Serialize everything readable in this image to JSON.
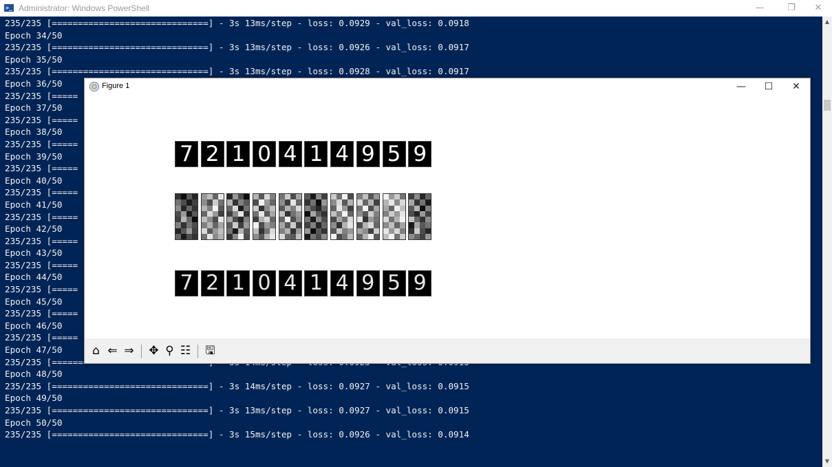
{
  "powershell": {
    "title": "Administrator: Windows PowerShell",
    "minimize": "—",
    "maximize": "❐",
    "close": "✕",
    "icon": "powershell-icon"
  },
  "console_lines": [
    "235/235 [==============================] - 3s 13ms/step - loss: 0.0929 - val_loss: 0.0918",
    "Epoch 34/50",
    "235/235 [==============================] - 3s 13ms/step - loss: 0.0926 - val_loss: 0.0917",
    "Epoch 35/50",
    "235/235 [==============================] - 3s 13ms/step - loss: 0.0928 - val_loss: 0.0917",
    "Epoch 36/50",
    "235/235 [=====",
    "Epoch 37/50",
    "235/235 [=====",
    "Epoch 38/50",
    "235/235 [=====",
    "Epoch 39/50",
    "235/235 [=====",
    "Epoch 40/50",
    "235/235 [=====",
    "Epoch 41/50",
    "235/235 [=====",
    "Epoch 42/50",
    "235/235 [=====",
    "Epoch 43/50",
    "235/235 [=====",
    "Epoch 44/50",
    "235/235 [=====",
    "Epoch 45/50",
    "235/235 [=====",
    "Epoch 46/50",
    "235/235 [=====",
    "Epoch 47/50",
    "235/235 [==============================] - 3s 14ms/step - loss: 0.0925 - val_loss: 0.0915",
    "Epoch 48/50",
    "235/235 [==============================] - 3s 14ms/step - loss: 0.0927 - val_loss: 0.0915",
    "Epoch 49/50",
    "235/235 [==============================] - 3s 13ms/step - loss: 0.0927 - val_loss: 0.0915",
    "Epoch 50/50",
    "235/235 [==============================] - 3s 15ms/step - loss: 0.0926 - val_loss: 0.0914"
  ],
  "figure": {
    "title": "Figure 1",
    "minimize": "—",
    "maximize": "☐",
    "close": "✕",
    "icon": "matplotlib-icon",
    "original_digits": [
      "7",
      "2",
      "1",
      "0",
      "4",
      "1",
      "4",
      "9",
      "5",
      "9"
    ],
    "reconstructed_digits": [
      "7",
      "2",
      "1",
      "0",
      "4",
      "1",
      "4",
      "9",
      "5",
      "9"
    ],
    "encoded_codes": [
      [
        0.2,
        0.05,
        0.35,
        0.15,
        0.45,
        0.3,
        0.1,
        0.25,
        0.55,
        0.15,
        0.4,
        0.2,
        0.3,
        0.6,
        0.1,
        0.35,
        0.25,
        0.7,
        0.4,
        0.05,
        0.5,
        0.2,
        0.45,
        0.3,
        0.15,
        0.35,
        0.6,
        0.25,
        0.4,
        0.1,
        0.3,
        0.2
      ],
      [
        0.6,
        0.75,
        0.4,
        0.9,
        0.55,
        0.3,
        0.8,
        0.45,
        0.7,
        0.5,
        0.95,
        0.35,
        0.4,
        0.85,
        0.6,
        0.25,
        0.75,
        0.55,
        0.3,
        0.9,
        0.5,
        0.7,
        0.4,
        0.65,
        0.85,
        0.35,
        0.6,
        0.75,
        0.45,
        0.9,
        0.55,
        0.7
      ],
      [
        0.15,
        0.6,
        0.3,
        0.05,
        0.7,
        0.2,
        0.5,
        0.35,
        0.4,
        0.85,
        0.1,
        0.45,
        0.25,
        0.55,
        0.9,
        0.2,
        0.65,
        0.3,
        0.15,
        0.5,
        0.35,
        0.8,
        0.25,
        0.6,
        0.45,
        0.1,
        0.7,
        0.35,
        0.2,
        0.55,
        0.95,
        0.3
      ],
      [
        0.7,
        0.35,
        0.85,
        0.5,
        0.3,
        0.95,
        0.6,
        0.4,
        0.8,
        0.2,
        0.55,
        0.75,
        0.45,
        0.9,
        0.35,
        0.65,
        0.25,
        0.7,
        0.85,
        0.4,
        0.95,
        0.3,
        0.6,
        0.5,
        0.75,
        0.2,
        0.45,
        0.85,
        0.55,
        0.35,
        0.7,
        0.9
      ],
      [
        0.45,
        0.8,
        0.3,
        0.65,
        0.55,
        0.25,
        0.9,
        0.4,
        0.35,
        0.7,
        0.5,
        0.85,
        0.75,
        0.2,
        0.45,
        0.6,
        0.4,
        0.95,
        0.3,
        0.55,
        0.65,
        0.35,
        0.8,
        0.25,
        0.5,
        0.7,
        0.2,
        0.6,
        0.85,
        0.4,
        0.35,
        0.75
      ],
      [
        0.35,
        0.1,
        0.55,
        0.25,
        0.2,
        0.45,
        0.05,
        0.6,
        0.5,
        0.3,
        0.15,
        0.4,
        0.05,
        0.65,
        0.35,
        0.2,
        0.45,
        0.1,
        0.55,
        0.3,
        0.25,
        0.5,
        0.15,
        0.4,
        0.6,
        0.05,
        0.35,
        0.2,
        0.1,
        0.45,
        0.3,
        0.55
      ],
      [
        0.8,
        0.45,
        0.95,
        0.3,
        0.55,
        0.85,
        0.35,
        0.7,
        0.4,
        0.9,
        0.6,
        0.25,
        0.75,
        0.5,
        0.95,
        0.4,
        0.3,
        0.65,
        0.45,
        0.85,
        0.55,
        0.2,
        0.7,
        0.9,
        0.35,
        0.8,
        0.5,
        0.6,
        0.95,
        0.3,
        0.45,
        0.75
      ],
      [
        0.5,
        0.75,
        0.35,
        0.6,
        0.85,
        0.4,
        0.7,
        0.25,
        0.45,
        0.95,
        0.3,
        0.65,
        0.55,
        0.35,
        0.8,
        0.5,
        0.9,
        0.2,
        0.6,
        0.45,
        0.3,
        0.7,
        0.85,
        0.4,
        0.65,
        0.55,
        0.25,
        0.8,
        0.4,
        0.7,
        0.95,
        0.35
      ],
      [
        0.95,
        0.6,
        0.8,
        0.45,
        0.7,
        0.9,
        0.55,
        0.85,
        0.65,
        0.4,
        0.95,
        0.75,
        0.5,
        0.8,
        0.6,
        0.9,
        0.85,
        0.45,
        0.7,
        0.95,
        0.55,
        0.75,
        0.4,
        0.65,
        0.9,
        0.6,
        0.85,
        0.5,
        0.75,
        0.95,
        0.45,
        0.8
      ],
      [
        0.25,
        0.55,
        0.15,
        0.4,
        0.65,
        0.2,
        0.45,
        0.1,
        0.35,
        0.7,
        0.05,
        0.5,
        0.3,
        0.15,
        0.6,
        0.25,
        0.75,
        0.4,
        0.2,
        0.55,
        0.1,
        0.65,
        0.35,
        0.45,
        0.2,
        0.8,
        0.3,
        0.15,
        0.55,
        0.4,
        0.25,
        0.6
      ]
    ]
  },
  "toolbar": {
    "home": "⌂",
    "back": "⇐",
    "forward": "⇒",
    "pan": "✥",
    "zoom": "⚲",
    "configure": "☷",
    "save": "🖫"
  },
  "scrollbar": {
    "up": "▲",
    "down": "▼"
  }
}
